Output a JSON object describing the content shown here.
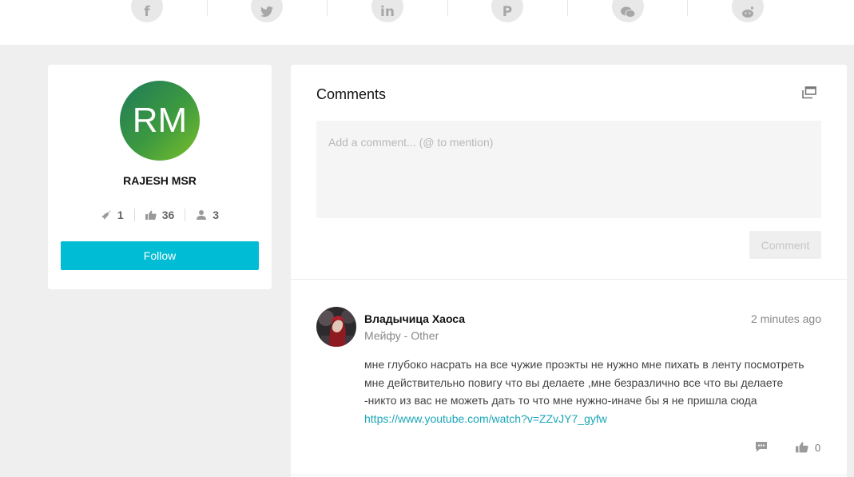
{
  "share": {
    "items": [
      {
        "name": "facebook-icon",
        "glyph": "f"
      },
      {
        "name": "twitter-icon",
        "glyph": "🐦"
      },
      {
        "name": "linkedin-icon",
        "glyph": "in"
      },
      {
        "name": "pinterest-icon",
        "glyph": "P"
      },
      {
        "name": "wechat-icon",
        "glyph": "✉"
      },
      {
        "name": "reddit-icon",
        "glyph": "●"
      }
    ]
  },
  "profile": {
    "initials": "RM",
    "name": "RAJESH MSR",
    "stats": {
      "projects": "1",
      "likes": "36",
      "followers": "3"
    },
    "follow_label": "Follow",
    "accent": "#00bcd4"
  },
  "comments": {
    "title": "Comments",
    "placeholder": "Add a comment... (@ to mention)",
    "submit_label": "Comment",
    "items": [
      {
        "author": "Владычица Хаоса",
        "subtitle": "Мейфу - Other",
        "time": "2 minutes ago",
        "text": "мне глубоко насрать на все чужие проэкты не нужно мне пихать в ленту посмотреть  мне действительно повигу что вы делаете ,мне безразлично  все что вы делаете -никто из вас не можеть дать то что мне нужно-иначе бы я не пришла сюда ",
        "link": "https://www.youtube.com/watch?v=ZZvJY7_gyfw",
        "likes": "0"
      }
    ]
  }
}
